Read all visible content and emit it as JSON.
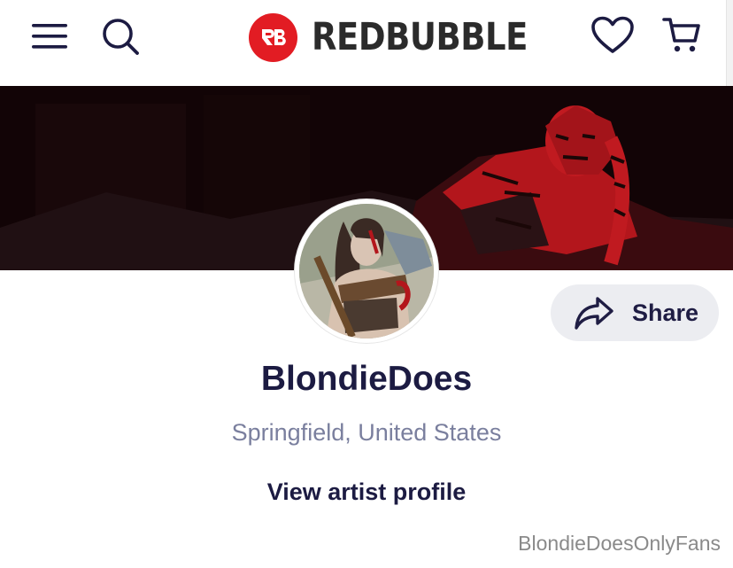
{
  "header": {
    "brand_name": "REDBUBBLE",
    "brand_color": "#e21c23",
    "icons": [
      "menu-icon",
      "search-icon",
      "heart-icon",
      "cart-icon"
    ]
  },
  "profile": {
    "artist_name": "BlondieDoes",
    "location": "Springfield, United States",
    "view_profile_label": "View artist profile",
    "share_label": "Share"
  },
  "watermark": "BlondieDoesOnlyFans",
  "colors": {
    "text_dark": "#1c1b42",
    "text_muted": "#7a7f9e",
    "share_bg": "#ecedf1"
  }
}
